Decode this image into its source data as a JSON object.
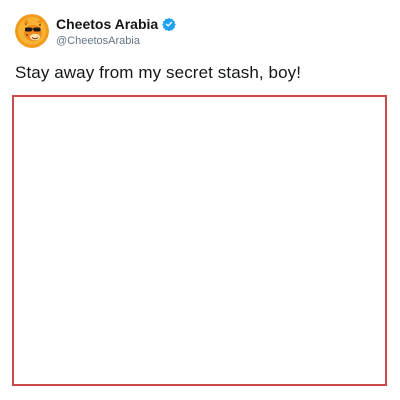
{
  "tweet": {
    "display_name": "Cheetos Arabia",
    "handle": "@CheetosArabia",
    "text": "Stay away from my secret stash, boy!",
    "verified": true,
    "avatar_icon": "cheetos-chester-avatar-icon",
    "verified_icon": "verified-badge-icon"
  },
  "colors": {
    "name": "#14171a",
    "handle": "#657786",
    "verified": "#1da1f2",
    "avatar_bg": "#f29a1b",
    "media_border": "#c94b4b"
  }
}
